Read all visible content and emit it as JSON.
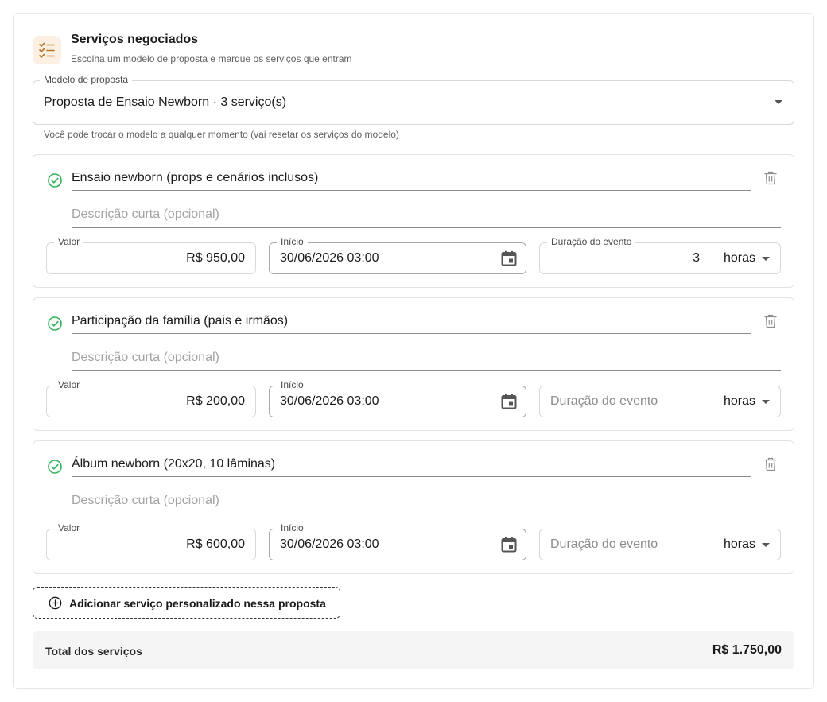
{
  "header": {
    "title": "Serviços negociados",
    "subtitle": "Escolha um modelo de proposta e marque os serviços que entram",
    "icon": "checklist-icon",
    "icon_bg": "#fbf0e2",
    "icon_color": "#b9722a"
  },
  "model": {
    "label": "Modelo de proposta",
    "value": "Proposta de Ensaio Newborn · 3 serviço(s)",
    "help": "Você pode trocar o modelo a qualquer momento (vai resetar os serviços do modelo)"
  },
  "labels": {
    "valor": "Valor",
    "inicio": "Início",
    "duracao": "Duração do evento",
    "desc_placeholder": "Descrição curta (opcional)",
    "duration_placeholder": "Duração do evento"
  },
  "services": [
    {
      "name": "Ensaio newborn (props e cenários inclusos)",
      "description": "",
      "valor": "R$ 950,00",
      "inicio": "30/06/2026 03:00",
      "duracao": "3",
      "unit": "horas",
      "checked": true
    },
    {
      "name": "Participação da família (pais e irmãos)",
      "description": "",
      "valor": "R$ 200,00",
      "inicio": "30/06/2026 03:00",
      "duracao": "",
      "unit": "horas",
      "checked": true
    },
    {
      "name": "Álbum newborn (20x20, 10 lâminas)",
      "description": "",
      "valor": "R$ 600,00",
      "inicio": "30/06/2026 03:00",
      "duracao": "",
      "unit": "horas",
      "checked": true
    }
  ],
  "add_button": "Adicionar serviço personalizado nessa proposta",
  "total": {
    "label": "Total dos serviços",
    "amount": "R$ 1.750,00"
  },
  "colors": {
    "check_green": "#2fb25a",
    "icon_gray": "#8f8f8f"
  }
}
